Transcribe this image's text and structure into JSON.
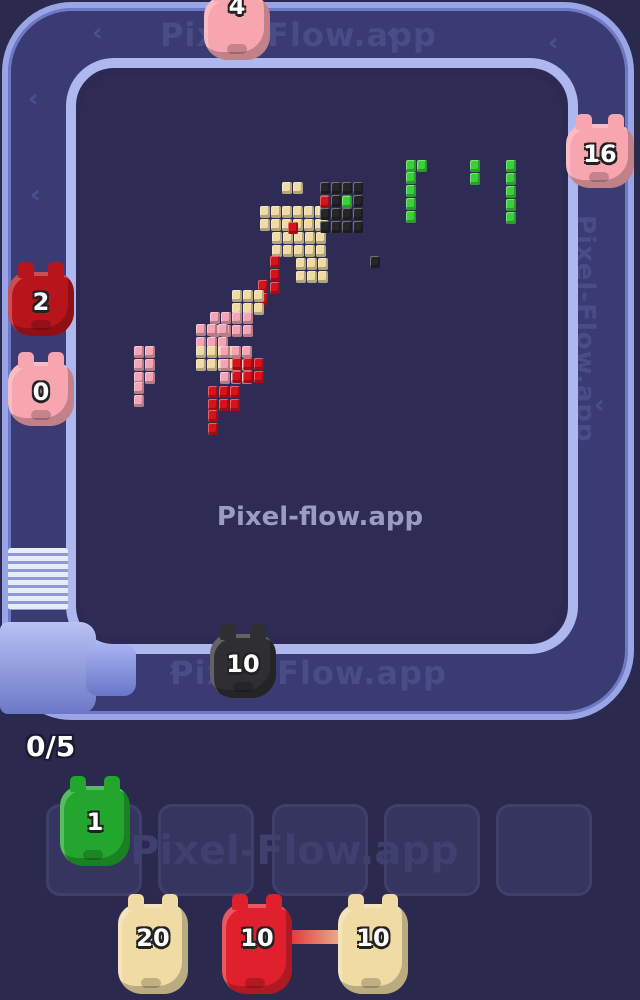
{
  "track": {
    "watermark_top": "Pixel-Flow.app",
    "watermark_bottom": "Pixel-Flow.app",
    "watermark_right": "Pixel-Flow.app"
  },
  "board": {
    "watermark": "Pixel-flow.app"
  },
  "pigs_on_track": [
    {
      "id": "top",
      "count": "4",
      "color": "#f7a6b0"
    },
    {
      "id": "right",
      "count": "16",
      "color": "#f7a6b0"
    },
    {
      "id": "left-red",
      "count": "2",
      "color": "#b8141c"
    },
    {
      "id": "left-pink",
      "count": "0",
      "color": "#f7a6b0"
    },
    {
      "id": "bottom-black",
      "count": "10",
      "color": "#2f2f33"
    }
  ],
  "slots": {
    "count": "0/5",
    "total": 5
  },
  "queue": [
    {
      "id": "green",
      "count": "1",
      "color": "#22a62e"
    },
    {
      "id": "cream",
      "count": "20",
      "color": "#f0dba4"
    },
    {
      "id": "red",
      "count": "10",
      "color": "#e0202c"
    },
    {
      "id": "cream-2",
      "count": "10",
      "color": "#f0dba4"
    }
  ],
  "colors": {
    "background": "#2b2a4e",
    "track": "#3a3b72",
    "rail": "#9aa5e6",
    "cream": "#f0dba4",
    "pink": "#f4a5b5",
    "red": "#d6121b",
    "green": "#3ad03a",
    "black": "#26262a"
  }
}
